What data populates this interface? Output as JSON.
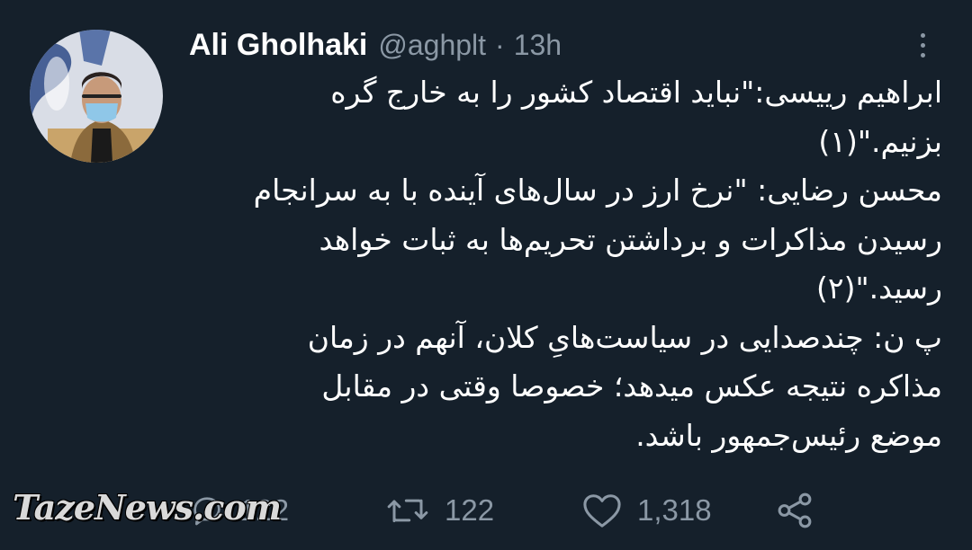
{
  "author": {
    "name": "Ali Gholhaki",
    "handle": "@aghplt",
    "separator": "·",
    "time": "13h"
  },
  "tweet": {
    "lines": [
      "ابراهیم رییسی:\"نباید اقتصاد کشور را به خارج گره",
      "بزنیم.\"(۱)",
      "محسن رضایی: \"نرخ ارز در سال‌های آینده با به سرانجام",
      "رسیدن مذاکرات و برداشتن تحریم‌ها به ثبات خواهد",
      "رسید.\"(۲)",
      "پ ن: چندصدایی در سیاست‌هایِ کلان، آنهم در زمان",
      "مذاکره نتیجه عکس میدهد؛ خصوصا وقتی در مقابل",
      "موضع رئیس‌جمهور باشد."
    ]
  },
  "actions": {
    "replies": "122",
    "retweets": "122",
    "likes": "1,318"
  },
  "watermark": "TazeNews.com",
  "icons": {
    "more": "more-vertical-icon",
    "reply": "reply-icon",
    "retweet": "retweet-icon",
    "like": "heart-icon",
    "share": "share-icon"
  },
  "colors": {
    "background": "#15202b",
    "text": "#ffffff",
    "secondary": "#8b98a5"
  }
}
